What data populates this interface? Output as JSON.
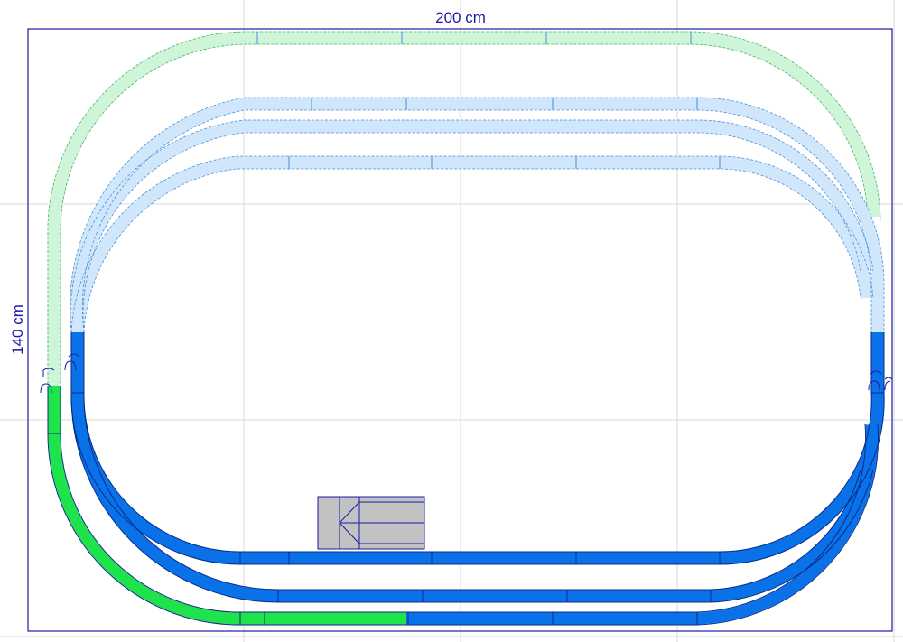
{
  "layout_plan": {
    "width_label": "200 cm",
    "height_label": "140 cm"
  },
  "colors": {
    "active_track": "#0a72e8",
    "active_track_edge": "#0b2a8a",
    "active_siding": "#1ee34a",
    "active_siding_edge": "#0b6b1a",
    "ghost_track": "#cfe6fb",
    "ghost_track_edge": "#4a8fd6",
    "ghost_siding": "#cff5d8",
    "ghost_siding_edge": "#49b36a",
    "grid": "#d8d8d8",
    "board_outline": "#1a1aa6",
    "building": "#c2c2c2",
    "building_edge": "#1a1aa6"
  },
  "objects": [
    {
      "name": "building-block",
      "icon": "arrow-left-icon"
    },
    {
      "name": "uncoupler-marker",
      "icon": "buffer-stop-icon"
    }
  ]
}
